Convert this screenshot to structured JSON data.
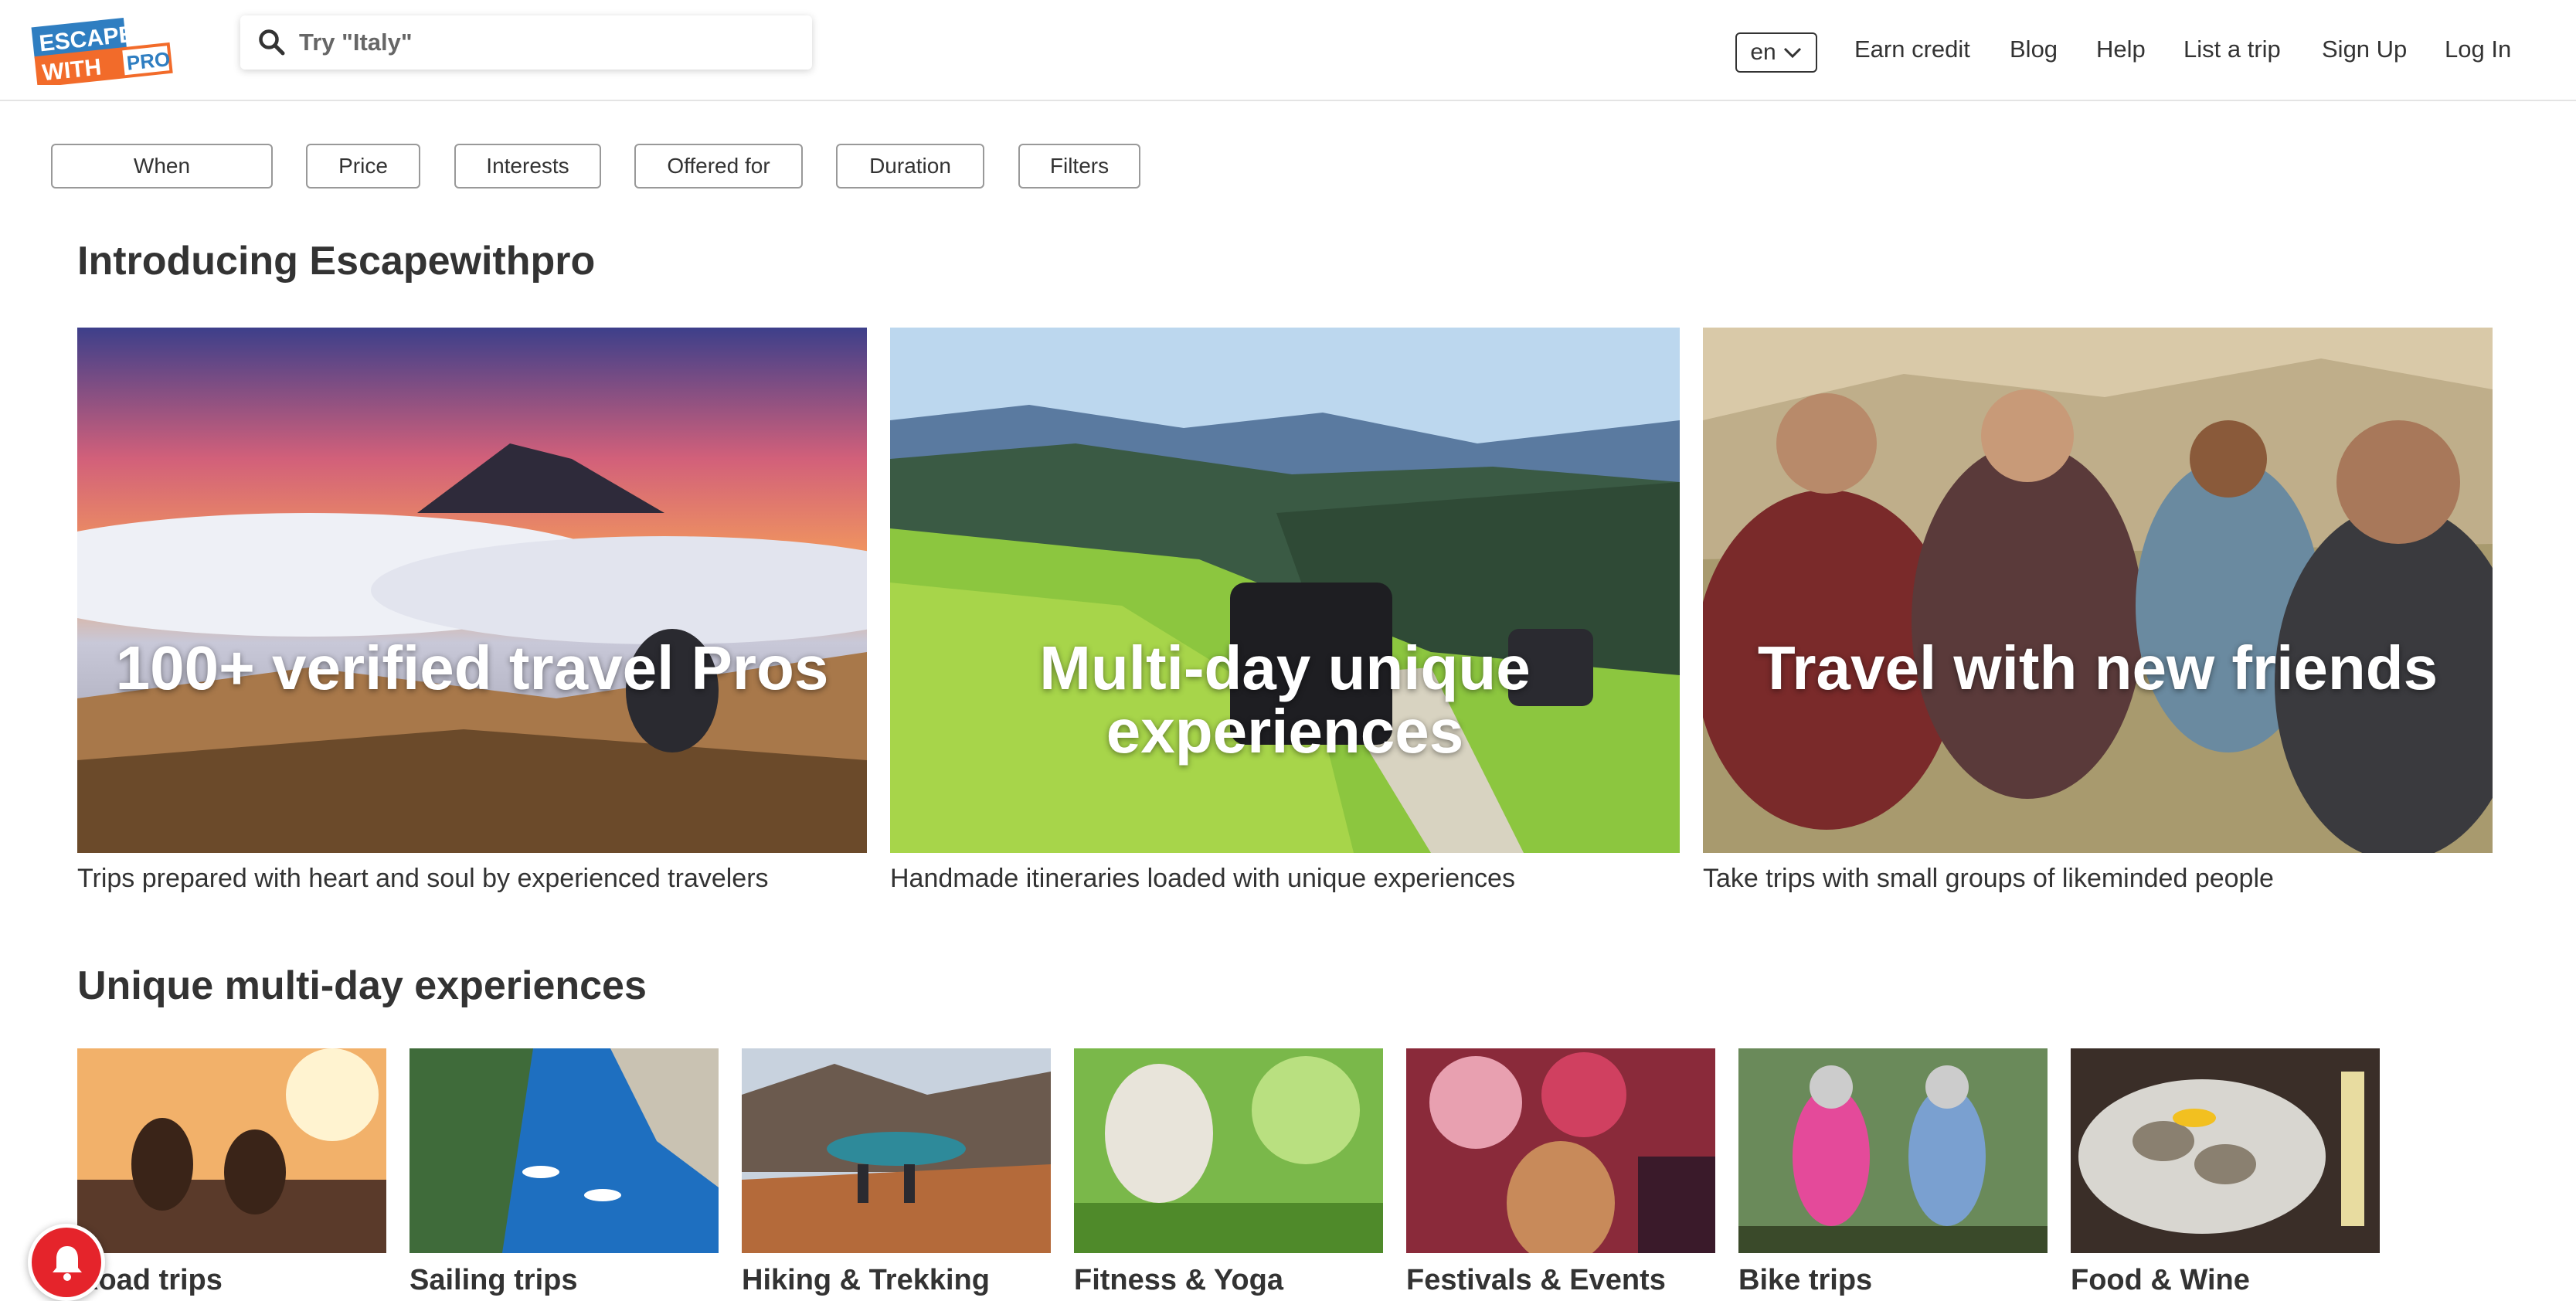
{
  "header": {
    "logo_top": "ESCAPE",
    "logo_bottom": "WITH",
    "logo_accent": "PRO",
    "search_placeholder": "Try \"Italy\"",
    "language": "en",
    "nav": [
      "Earn credit",
      "Blog",
      "Help",
      "List a trip",
      "Sign Up",
      "Log In"
    ]
  },
  "filters": [
    "When",
    "Price",
    "Interests",
    "Offered for",
    "Duration",
    "Filters"
  ],
  "intro": {
    "title": "Introducing Escapewithpro",
    "cards": [
      {
        "title": "100+ verified travel Pros",
        "caption": "Trips prepared with heart and soul by experienced travelers"
      },
      {
        "title": "Multi-day unique experiences",
        "caption": "Handmade itineraries loaded with unique experiences"
      },
      {
        "title": "Travel with new friends",
        "caption": "Take trips with small groups of likeminded people"
      }
    ]
  },
  "experiences": {
    "title": "Unique multi-day experiences",
    "items": [
      "Road trips",
      "Sailing trips",
      "Hiking & Trekking",
      "Fitness & Yoga",
      "Festivals & Events",
      "Bike trips",
      "Food & Wine"
    ]
  },
  "colors": {
    "brand_blue": "#2f7ec1",
    "brand_orange": "#f26b2a",
    "notify_red": "#e5242b",
    "text": "#333333"
  },
  "icons": [
    "search-icon",
    "chevron-down-icon",
    "bell-icon"
  ]
}
